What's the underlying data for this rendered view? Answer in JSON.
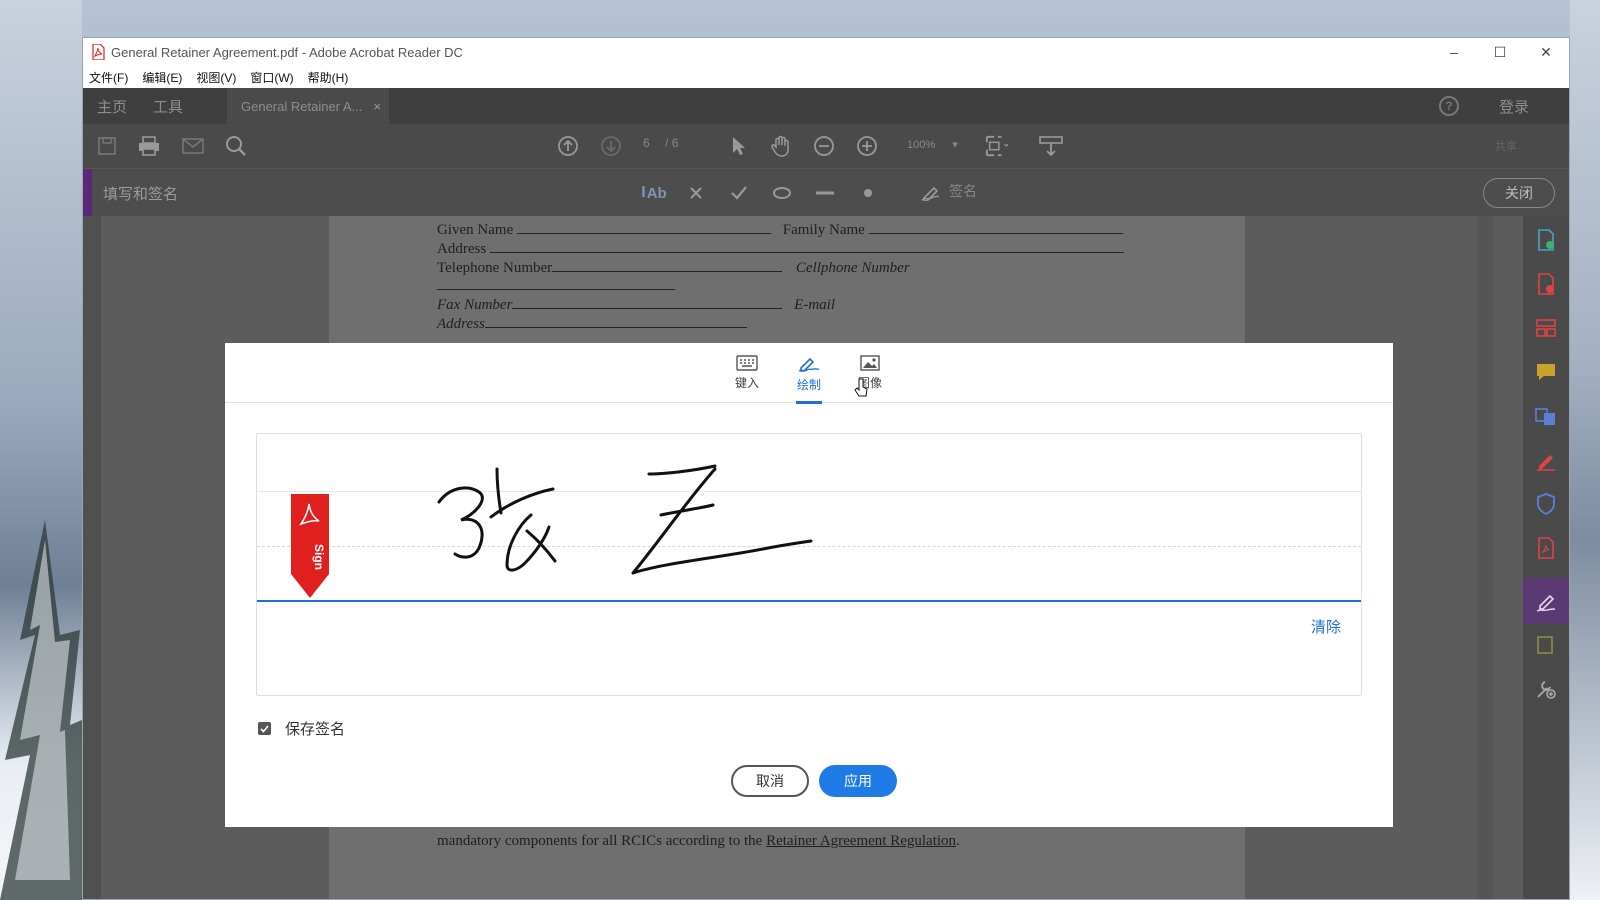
{
  "window": {
    "title": "General Retainer Agreement.pdf - Adobe Acrobat Reader DC",
    "controls": [
      "–",
      "☐",
      "✕"
    ]
  },
  "menubar": {
    "items": [
      "文件(F)",
      "编辑(E)",
      "视图(V)",
      "窗口(W)",
      "帮助(H)"
    ]
  },
  "tabs": {
    "home": "主页",
    "tools": "工具",
    "document": "General Retainer A...",
    "close": "×"
  },
  "header_right": {
    "help": "?",
    "login": "登录"
  },
  "toolbar": {
    "page_current": "6",
    "page_total": "/ 6",
    "zoom": "100%",
    "share": "共享"
  },
  "fillsign": {
    "label": "填写和签名",
    "text_tool": "Ab",
    "sign": "签名",
    "close": "关闭"
  },
  "document": {
    "given_name": "Given Name",
    "family_name": "Family Name",
    "address": "Address",
    "telephone": "Telephone Number",
    "cellphone": "Cellphone Number",
    "fax": "Fax Number",
    "email": "E-mail",
    "address2": "Address",
    "footer_text": "mandatory components for all RCICs according to the",
    "footer_link": "Retainer Agreement Regulation",
    "footer_end": "."
  },
  "dialog": {
    "modes": [
      {
        "label": "键入",
        "icon": "keyboard-icon"
      },
      {
        "label": "绘制",
        "icon": "pen-draw-icon",
        "active": true
      },
      {
        "label": "图像",
        "icon": "image-icon"
      }
    ],
    "badge": "Sign",
    "clear": "清除",
    "save_label": "保存签名",
    "save_checked": true,
    "cancel": "取消",
    "apply": "应用"
  },
  "colors": {
    "accent": "#1e7be6",
    "sign_badge": "#e0201f",
    "fill_accent": "#5a2a78"
  }
}
